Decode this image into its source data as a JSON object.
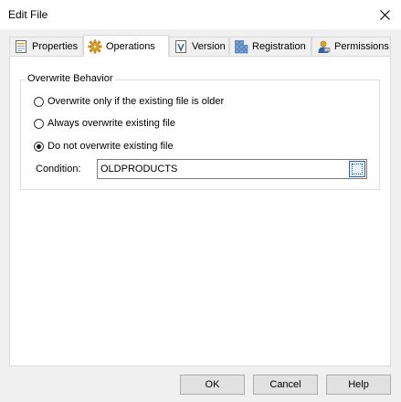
{
  "window": {
    "title": "Edit File"
  },
  "tabs": [
    {
      "label": "Properties",
      "icon": "properties-icon",
      "active": false
    },
    {
      "label": "Operations",
      "icon": "gear-icon",
      "active": true
    },
    {
      "label": "Version",
      "icon": "version-icon",
      "active": false
    },
    {
      "label": "Registration",
      "icon": "registry-icon",
      "active": false
    },
    {
      "label": "Permissions",
      "icon": "permissions-icon",
      "active": false
    }
  ],
  "overwrite": {
    "group_label": "Overwrite Behavior",
    "options": [
      {
        "label": "Overwrite only if the existing file is older",
        "checked": false
      },
      {
        "label": "Always overwrite existing file",
        "checked": false
      },
      {
        "label": "Do not overwrite existing file",
        "checked": true
      }
    ],
    "condition_label": "Condition:",
    "condition_value": "OLDPRODUCTS"
  },
  "buttons": {
    "ok": "OK",
    "cancel": "Cancel",
    "help": "Help"
  },
  "colors": {
    "accent": "#2c5fa8",
    "gear": "#e8a317"
  }
}
